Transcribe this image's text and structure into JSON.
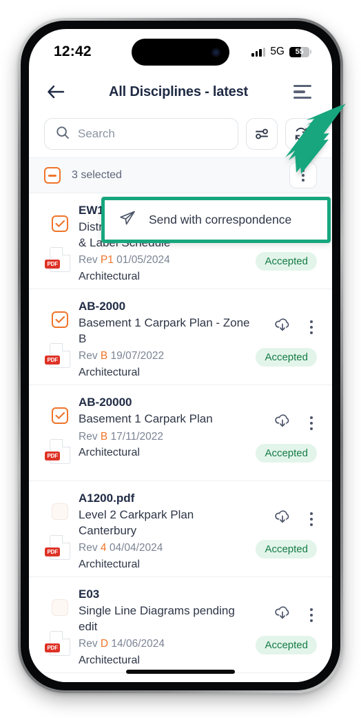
{
  "status_bar": {
    "time": "12:42",
    "network": "5G",
    "battery_level": "55",
    "signal_icon": "cellular-signal-icon",
    "battery_icon": "battery-icon"
  },
  "header": {
    "back_icon": "back-arrow-icon",
    "title": "All Disciplines - latest",
    "menu_icon": "hamburger-menu-icon"
  },
  "search": {
    "placeholder": "Search",
    "search_icon": "search-icon",
    "filter_icon": "filter-sliders-icon",
    "refresh_icon": "refresh-icon"
  },
  "selection_bar": {
    "checkbox_state": "indeterminate",
    "label": "3 selected",
    "kebab_icon": "more-options-icon"
  },
  "popup_menu": {
    "highlight_color": "#17a67e",
    "items": [
      {
        "label": "Send with correspondence",
        "icon": "send-paper-plane-icon"
      }
    ]
  },
  "annotation": {
    "arrow_color": "#17a67e",
    "points_to": "selection-bar-kebab-button"
  },
  "documents": [
    {
      "code": "EW102",
      "title": "Distrib",
      "title_line2": "& Label Schedule",
      "rev_label": "Rev",
      "rev_value": "P1",
      "date": "01/05/2024",
      "discipline": "Architectural",
      "status": "Accepted",
      "selected": true,
      "file_type": "PDF",
      "download_icon": "cloud-download-icon",
      "kebab_icon": "more-options-icon"
    },
    {
      "code": "AB-2000",
      "title": "Basement 1 Carpark Plan - Zone B",
      "rev_label": "Rev",
      "rev_value": "B",
      "date": "19/07/2022",
      "discipline": "Architectural",
      "status": "Accepted",
      "selected": true,
      "file_type": "PDF",
      "download_icon": "cloud-download-icon",
      "kebab_icon": "more-options-icon"
    },
    {
      "code": "AB-20000",
      "title": "Basement 1 Carpark Plan",
      "rev_label": "Rev",
      "rev_value": "B",
      "date": "17/11/2022",
      "discipline": "Architectural",
      "status": "Accepted",
      "selected": true,
      "file_type": "PDF",
      "download_icon": "cloud-download-icon",
      "kebab_icon": "more-options-icon"
    },
    {
      "code": "A1200.pdf",
      "title": "Level 2 Carkpark Plan Canterbury",
      "rev_label": "Rev",
      "rev_value": "4",
      "date": "04/04/2024",
      "discipline": "Architectural",
      "status": "Accepted",
      "selected": false,
      "file_type": "PDF",
      "download_icon": "cloud-download-icon",
      "kebab_icon": "more-options-icon"
    },
    {
      "code": "E03",
      "title": "Single Line Diagrams pending edit",
      "rev_label": "Rev",
      "rev_value": "D",
      "date": "14/06/2024",
      "discipline": "Architectural",
      "status": "Accepted",
      "selected": false,
      "file_type": "PDF",
      "download_icon": "cloud-download-icon",
      "kebab_icon": "more-options-icon"
    }
  ],
  "colors": {
    "accent_orange": "#ef7429",
    "accent_teal": "#17a67e",
    "status_green_text": "#147a45",
    "status_green_bg": "#e3f5ea",
    "pdf_red": "#de3226",
    "text_dark": "#1f2a44"
  }
}
